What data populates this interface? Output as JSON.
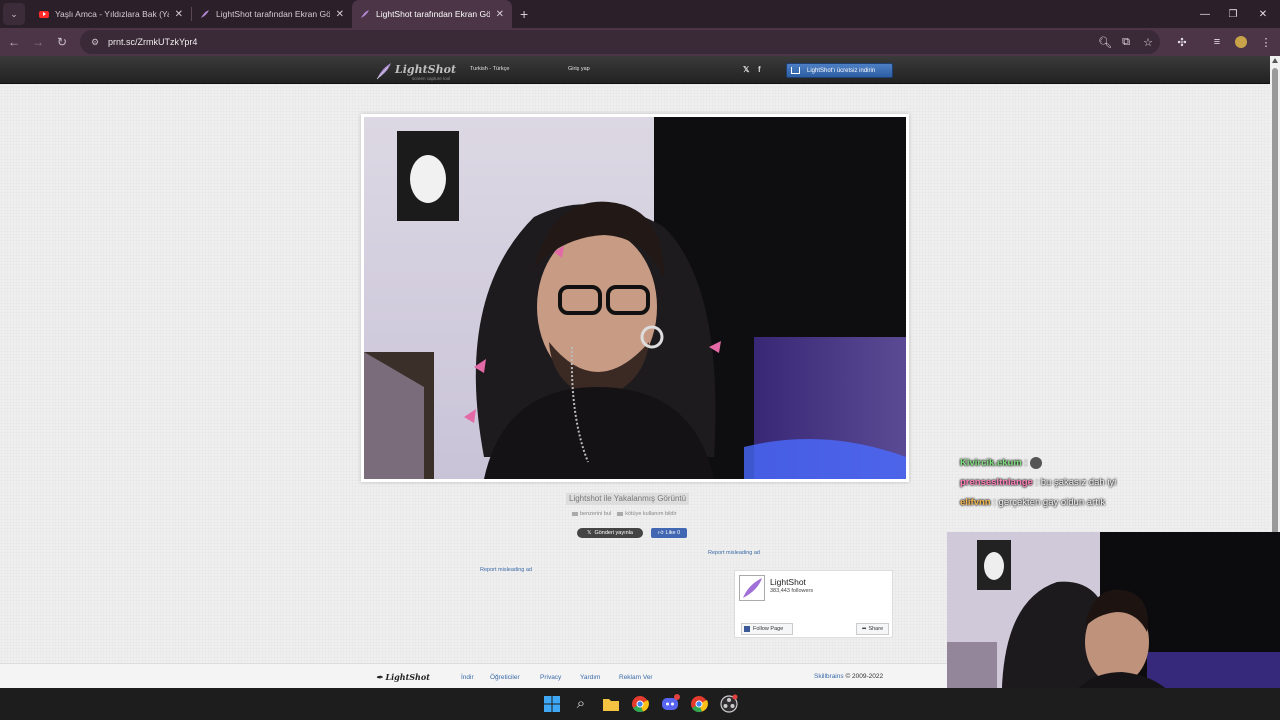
{
  "browser": {
    "tabs": [
      {
        "title": "Yaşlı Amca - Yıldızlara Bak (Yaşlı",
        "favicon": "youtube-icon",
        "active": false
      },
      {
        "title": "LightShot tarafından Ekran Görü",
        "favicon": "lightshot-feather-icon",
        "active": false
      },
      {
        "title": "LightShot tarafından Ekran Görü",
        "favicon": "lightshot-feather-icon",
        "active": true
      }
    ],
    "url": "prnt.sc/ZrmkUTzkYpr4",
    "colors": {
      "tabbar": "#2b1f29",
      "toolbar": "#4b3547",
      "omnibox": "#3a2936"
    }
  },
  "header": {
    "logo_text": "LightShot",
    "logo_tagline": "screen capture tool",
    "language": "Turkish - Türkçe",
    "login": "Giriş yap",
    "download_button": "LightShot'ı ücretsiz indirin",
    "social": [
      "twitter-icon",
      "facebook-icon"
    ]
  },
  "image": {
    "caption": "Lightshot ile Yakalanmış Görüntü",
    "find_similar": "benzerini bul",
    "report_abuse": "kötüye kullanım bildir",
    "tweet_button": "Gönderi yayınla",
    "like_button": "Like 0"
  },
  "ads": {
    "report_right": "Report misleading ad",
    "report_left": "Report misleading ad"
  },
  "facebook_box": {
    "page_name": "LightShot",
    "followers": "383,443 followers",
    "follow_button": "Follow Page",
    "share_button": "Share"
  },
  "footer": {
    "logo": "LightShot",
    "links": [
      "İndir",
      "Öğreticiler",
      "Privacy",
      "Yardım",
      "Reklam Ver"
    ],
    "company": "Skillbrains",
    "copyright": "© 2009-2022"
  },
  "chat": [
    {
      "user": "Kivircik.ekum",
      "text": ":",
      "color": "#7fe07f"
    },
    {
      "user": "prensesltnlange",
      "text": ": bu şakasız dah iyi",
      "color": "#ff7eb6"
    },
    {
      "user": "elifvnn",
      "text": ": gerçekten gay oldun artık",
      "color": "#f2b64f"
    }
  ],
  "taskbar": {
    "icons": [
      "windows-start-icon",
      "search-icon",
      "file-explorer-icon",
      "chrome-icon",
      "discord-icon",
      "chrome-icon",
      "obs-icon"
    ]
  }
}
